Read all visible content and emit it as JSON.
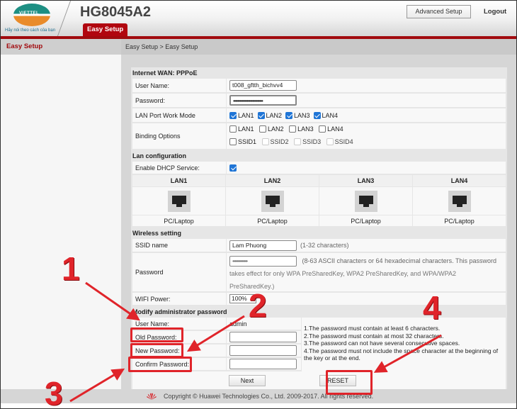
{
  "header": {
    "brand_name": "VIETTEL",
    "brand_slogan": "Hãy nói theo cách của bạn",
    "model": "HG8045A2",
    "active_tab": "Easy Setup",
    "advanced_setup_label": "Advanced Setup",
    "logout_label": "Logout",
    "accent_color": "#a10a0e"
  },
  "sidebar": {
    "items": [
      {
        "label": "Easy Setup",
        "active": true
      }
    ]
  },
  "breadcrumb": "Easy Setup > Easy Setup",
  "wan": {
    "title": "Internet WAN: PPPoE",
    "user_name_label": "User Name:",
    "user_name_value": "t008_gftth_bichvv4",
    "password_label": "Password:",
    "password_value": "••••••••••••••••••••••••••••",
    "lan_mode_label": "LAN Port Work Mode",
    "lan_mode_options": [
      {
        "label": "LAN1",
        "checked": true
      },
      {
        "label": "LAN2",
        "checked": true
      },
      {
        "label": "LAN3",
        "checked": true
      },
      {
        "label": "LAN4",
        "checked": true
      }
    ],
    "binding_label": "Binding Options",
    "binding_lan": [
      {
        "label": "LAN1",
        "checked": false
      },
      {
        "label": "LAN2",
        "checked": false
      },
      {
        "label": "LAN3",
        "checked": false
      },
      {
        "label": "LAN4",
        "checked": false
      }
    ],
    "binding_ssid": [
      {
        "label": "SSID1",
        "checked": false,
        "disabled": false
      },
      {
        "label": "SSID2",
        "checked": false,
        "disabled": true
      },
      {
        "label": "SSID3",
        "checked": false,
        "disabled": true
      },
      {
        "label": "SSID4",
        "checked": false,
        "disabled": true
      }
    ]
  },
  "lan_config": {
    "title": "Lan configuration",
    "dhcp_label": "Enable DHCP Service:",
    "dhcp_enabled": true,
    "ports": [
      {
        "name": "LAN1",
        "device": "PC/Laptop"
      },
      {
        "name": "LAN2",
        "device": "PC/Laptop"
      },
      {
        "name": "LAN3",
        "device": "PC/Laptop"
      },
      {
        "name": "LAN4",
        "device": "PC/Laptop"
      }
    ]
  },
  "wireless": {
    "title": "Wireless setting",
    "ssid_label": "SSID name",
    "ssid_value": "Lam Phuong",
    "ssid_hint": "(1-32 characters)",
    "password_label": "Password",
    "password_value": "••••••••••••••",
    "password_hint_1": "(8-63 ASCII characters or 64 hexadecimal characters. This password",
    "password_hint_2": "takes effect for only WPA PreSharedKey, WPA2 PreSharedKey, and WPA/WPA2",
    "password_hint_3": "PreSharedKey.)",
    "power_label": "WIFI Power:",
    "power_value": "100%"
  },
  "admin": {
    "title": "Modify administrator password",
    "user_name_label": "User Name:",
    "user_name_value": "admin",
    "old_password_label": "Old Password:",
    "new_password_label": "New Password:",
    "confirm_password_label": "Confirm Password:",
    "old_password_value": "",
    "new_password_value": "",
    "confirm_password_value": "",
    "rules": [
      "1.The password must contain at least 6 characters.",
      "2.The password must contain at most 32 characters.",
      "3.The password can not have several conseçutive spaces.",
      "4.The password must not include the space character at the beginning of the key or at the end."
    ],
    "next_label": "Next",
    "reset_label": "RESET"
  },
  "footer": {
    "copyright": "Copyright © Huawei Technologies Co., Ltd. 2009-2017. All rights reserved."
  },
  "annotations": {
    "color": "#e0242a",
    "steps": [
      "1",
      "2",
      "3",
      "4"
    ]
  }
}
